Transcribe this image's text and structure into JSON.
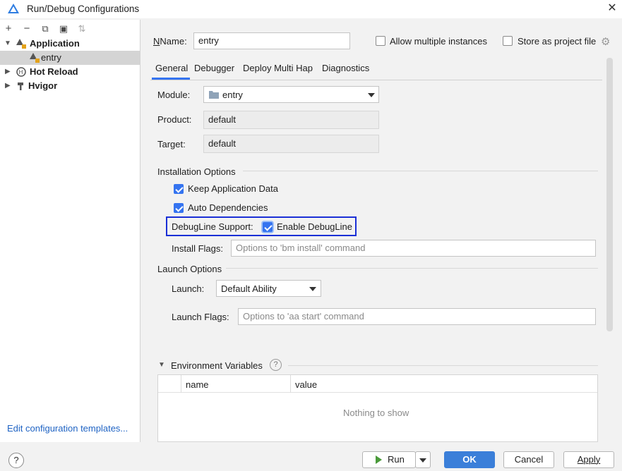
{
  "window": {
    "title": "Run/Debug Configurations",
    "close_glyph": "✕"
  },
  "toolbar": {
    "add": "+",
    "remove": "−",
    "copy": "⧉",
    "folder": "▣",
    "sort": "⇅"
  },
  "tree": {
    "items": [
      {
        "label": "Application",
        "expanded": true
      },
      {
        "label": "entry",
        "selected": true
      },
      {
        "label": "Hot Reload",
        "expanded": false
      },
      {
        "label": "Hvigor",
        "expanded": false
      }
    ],
    "edit_templates_link": "Edit configuration templates..."
  },
  "help_glyph": "?",
  "form": {
    "name_label": "Name:",
    "name_value": "entry",
    "allow_multiple": {
      "label": "Allow multiple instances",
      "checked": false
    },
    "store_project": {
      "label": "Store as project file",
      "checked": false
    },
    "tabs": [
      "General",
      "Debugger",
      "Deploy Multi Hap",
      "Diagnostics"
    ],
    "active_tab": "General",
    "module_label": "Module:",
    "module_value": "entry",
    "product_label": "Product:",
    "product_value": "default",
    "target_label": "Target:",
    "target_value": "default",
    "installation_options": "Installation Options",
    "keep_app_data": {
      "label": "Keep Application Data",
      "checked": true
    },
    "auto_dependencies": {
      "label": "Auto Dependencies",
      "checked": true
    },
    "debugline_label": "DebugLine Support:",
    "enable_debugline": {
      "label": "Enable DebugLine",
      "checked": true
    },
    "install_flags_label": "Install Flags:",
    "install_flags_placeholder": "Options to 'bm install' command",
    "launch_options": "Launch Options",
    "launch_label": "Launch:",
    "launch_value": "Default Ability",
    "launch_flags_label": "Launch Flags:",
    "launch_flags_placeholder": "Options to 'aa start' command",
    "env_vars": "Environment Variables",
    "env_help": "?",
    "env_columns": [
      "name",
      "value"
    ],
    "env_empty": "Nothing to show"
  },
  "buttons": {
    "run": "Run",
    "ok": "OK",
    "cancel": "Cancel",
    "apply": "Apply"
  },
  "colors": {
    "accent": "#3574f0",
    "ok_button": "#3b7fd9",
    "highlight_border": "#1a2fd6",
    "link": "#2064c4"
  }
}
